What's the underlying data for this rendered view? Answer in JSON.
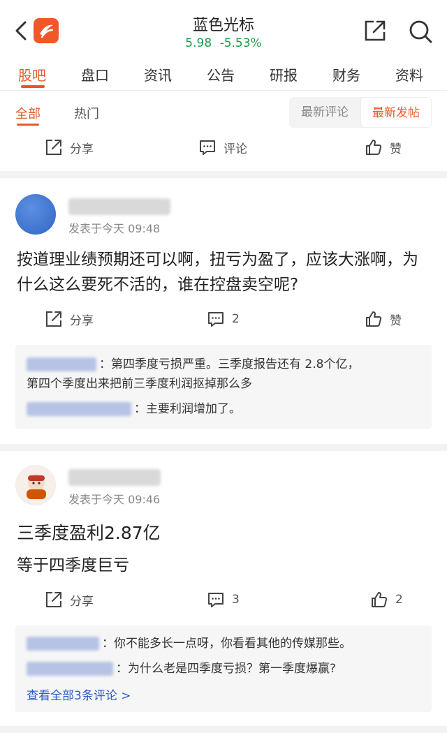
{
  "header": {
    "title": "蓝色光标",
    "price": "5.98",
    "change": "-5.53%"
  },
  "tabs": [
    "股吧",
    "盘口",
    "资讯",
    "公告",
    "研报",
    "财务",
    "资料"
  ],
  "filter": {
    "all": "全部",
    "hot": "热门",
    "latest_comment": "最新评论",
    "latest_post": "最新发帖"
  },
  "actions": {
    "share": "分享",
    "comment": "评论",
    "like": "赞"
  },
  "posts": [
    {
      "time": "发表于今天 09:48",
      "text": "按道理业绩预期还可以啊，扭亏为盈了，应该大涨啊，为什么这么要死不活的，谁在控盘卖空呢?",
      "share": "分享",
      "comments": "2",
      "likes": "赞",
      "replies": [
        {
          "sep": "：",
          "text": "第四季度亏损严重。三季度报告还有 2.8个亿，",
          "text2": "第四个季度出来把前三季度利润抠掉那么多"
        },
        {
          "sep": "：",
          "text": "主要利润增加了。",
          "text2": ""
        }
      ]
    },
    {
      "time": "发表于今天 09:46",
      "title": "三季度盈利2.87亿",
      "text": "等于四季度巨亏",
      "share": "分享",
      "comments": "3",
      "likes": "2",
      "replies": [
        {
          "sep": "：",
          "text": "你不能多长一点呀，你看看其他的传媒那些。"
        },
        {
          "sep": "：",
          "text": "为什么老是四季度亏损？第一季度爆赢?"
        }
      ],
      "view_all": "查看全部3条评论 >"
    }
  ],
  "colors": {
    "accent": "#e65a2a",
    "price_green": "#1a9b4a",
    "link_blue": "#2a5ec2"
  }
}
